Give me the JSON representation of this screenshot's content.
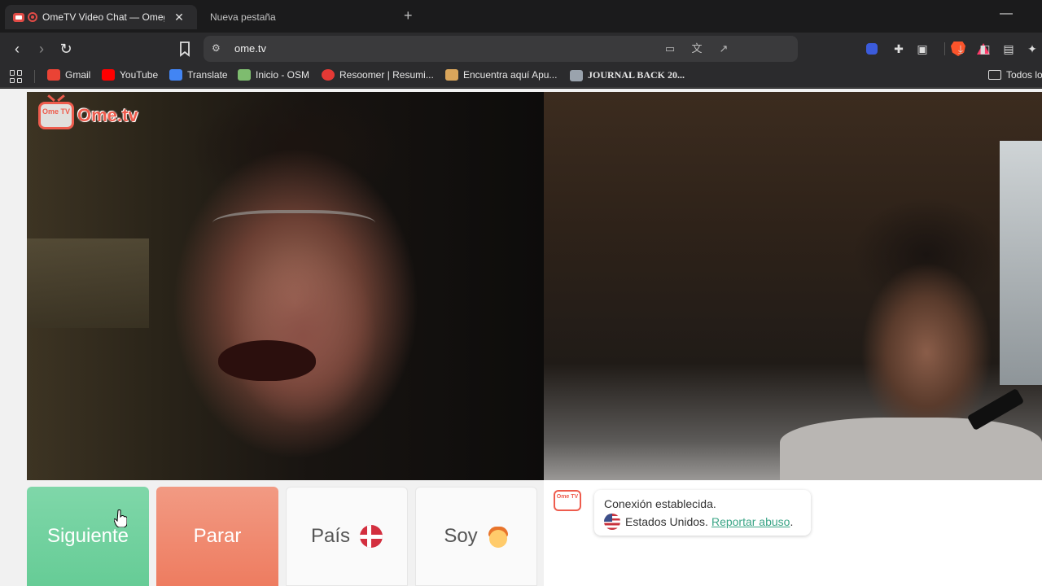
{
  "browser": {
    "tabs": [
      {
        "title": "OmeTV Video Chat — Omeg",
        "active": true
      },
      {
        "title": "Nueva pestaña",
        "active": false
      }
    ],
    "url": "ome.tv",
    "bookmarks": [
      {
        "label": "Gmail",
        "icon": "gmail-icon",
        "color": "#ea4335"
      },
      {
        "label": "YouTube",
        "icon": "youtube-icon",
        "color": "#ff0000"
      },
      {
        "label": "Translate",
        "icon": "translate-icon",
        "color": "#4285f4"
      },
      {
        "label": "Inicio - OSM",
        "icon": "osm-icon",
        "color": "#7ebc6f"
      },
      {
        "label": "Resoomer | Resumi...",
        "icon": "resoomer-icon",
        "color": "#e53935"
      },
      {
        "label": "Encuentra aquí Apu...",
        "icon": "apuntes-icon",
        "color": "#d9a55b"
      },
      {
        "label": "JOURNAL BACK 20...",
        "icon": "journal-icon",
        "color": "#9aa3ad"
      }
    ],
    "all_bookmarks_label": "Todos lo"
  },
  "app": {
    "logo_text": "Ome.tv",
    "logo_badge": "Ome TV",
    "buttons": {
      "next": "Siguiente",
      "stop": "Parar",
      "country": "País",
      "gender": "Soy"
    },
    "chat": {
      "status": "Conexión establecida.",
      "country": "Estados Unidos.",
      "report": "Reportar abuso",
      "report_suffix": "."
    },
    "colors": {
      "next": "#6fd09c",
      "stop": "#ef8066",
      "brand": "#ee5c4d",
      "link": "#3aa586"
    }
  }
}
